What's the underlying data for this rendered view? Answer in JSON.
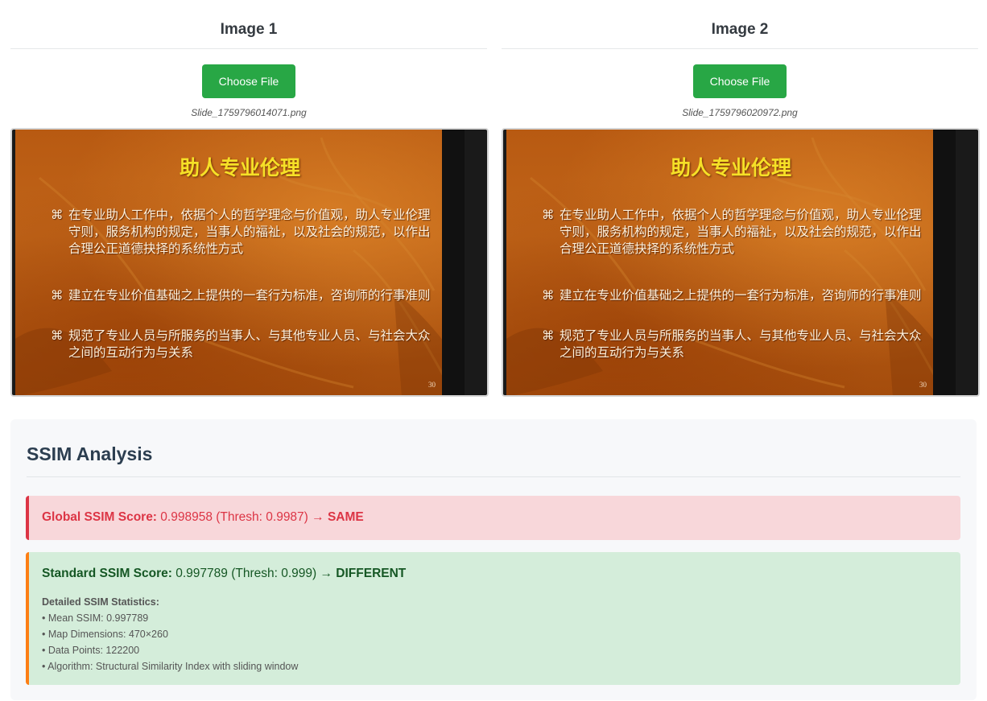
{
  "image1": {
    "title": "Image 1",
    "button_label": "Choose File",
    "file_name": "Slide_1759796014071.png"
  },
  "image2": {
    "title": "Image 2",
    "button_label": "Choose File",
    "file_name": "Slide_1759796020972.png"
  },
  "slide": {
    "title": "助人专业伦理",
    "bullet_mark": "⌘",
    "bullets": [
      "在专业助人工作中，依据个人的哲学理念与价值观，助人专业伦理守则，服务机构的规定，当事人的福祉，以及社会的规范，以作出合理公正道德抉择的系统性方式",
      "建立在专业价值基础之上提供的一套行为标准，咨询师的行事准则",
      "规范了专业人员与所服务的当事人、与其他专业人员、与社会大众之间的互动行为与关系"
    ],
    "page_number": "30"
  },
  "analysis": {
    "title": "SSIM Analysis",
    "global": {
      "label": "Global SSIM Score:",
      "value": "0.998958 (Thresh: 0.9987) →",
      "verdict": "SAME"
    },
    "standard": {
      "label": "Standard SSIM Score:",
      "value": "0.997789 (Thresh: 0.999) →",
      "verdict": "DIFFERENT"
    },
    "details": {
      "title": "Detailed SSIM Statistics:",
      "items": [
        "• Mean SSIM: 0.997789",
        "• Map Dimensions: 470×260",
        "• Data Points: 122200",
        "• Algorithm: Structural Similarity Index with sliding window"
      ]
    }
  },
  "colors": {
    "button": "#28a745",
    "same": "#dc3545",
    "different": "#155724",
    "slide_title": "#f6e027"
  }
}
